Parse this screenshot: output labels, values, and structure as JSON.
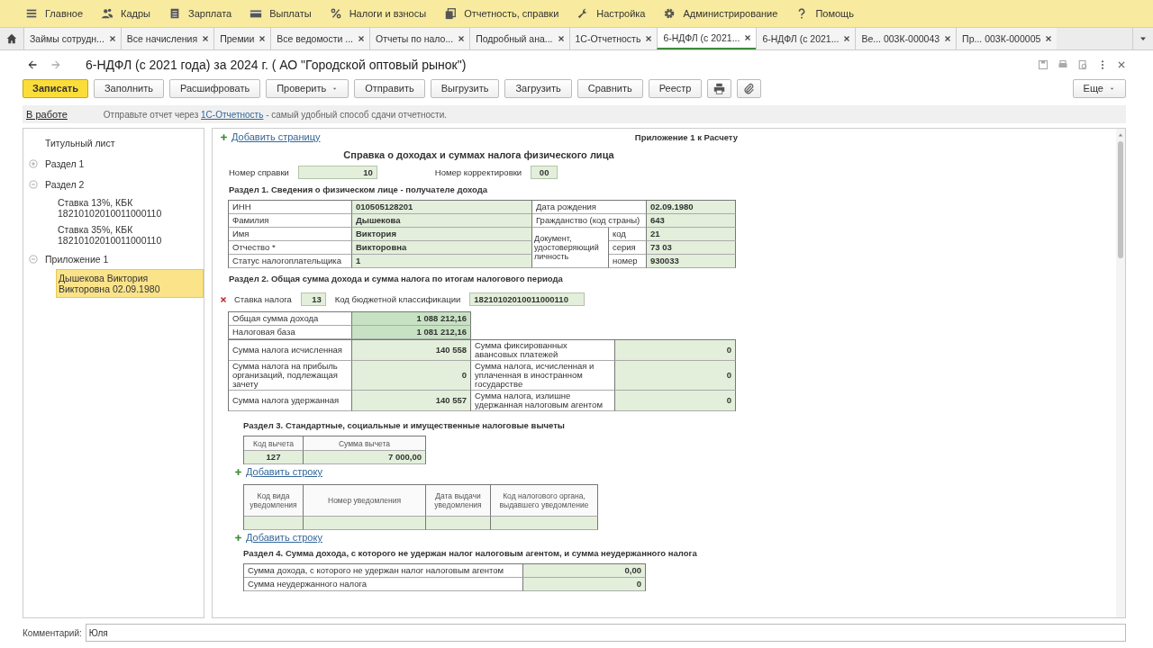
{
  "menu": [
    {
      "label": "Главное"
    },
    {
      "label": "Кадры"
    },
    {
      "label": "Зарплата"
    },
    {
      "label": "Выплаты"
    },
    {
      "label": "Налоги и взносы"
    },
    {
      "label": "Отчетность, справки"
    },
    {
      "label": "Настройка"
    },
    {
      "label": "Администрирование"
    },
    {
      "label": "Помощь"
    }
  ],
  "tabs": [
    {
      "label": "Займы сотрудн...",
      "selected": false
    },
    {
      "label": "Все начисления",
      "selected": false
    },
    {
      "label": "Премии",
      "selected": false
    },
    {
      "label": "Все ведомости ...",
      "selected": false
    },
    {
      "label": "Отчеты по нало...",
      "selected": false
    },
    {
      "label": "Подробный ана...",
      "selected": false
    },
    {
      "label": "1С-Отчетность",
      "selected": false
    },
    {
      "label": "6-НДФЛ (с 2021...",
      "selected": true
    },
    {
      "label": "6-НДФЛ (с 2021...",
      "selected": false
    },
    {
      "label": "Ве... 003К-000043",
      "selected": false
    },
    {
      "label": "Пр... 003К-000005",
      "selected": false
    }
  ],
  "window": {
    "title": "6-НДФЛ (с 2021 года) за 2024 г. ( АО \"Городской оптовый рынок\")"
  },
  "toolbar": [
    {
      "kind": "primary",
      "label": "Записать"
    },
    {
      "kind": "plain",
      "label": "Заполнить"
    },
    {
      "kind": "plain",
      "label": "Расшифровать"
    },
    {
      "kind": "menu",
      "label": "Проверить"
    },
    {
      "kind": "plain",
      "label": "Отправить"
    },
    {
      "kind": "plain",
      "label": "Выгрузить"
    },
    {
      "kind": "plain",
      "label": "Загрузить"
    },
    {
      "kind": "plain",
      "label": "Сравнить"
    },
    {
      "kind": "plain",
      "label": "Реестр"
    },
    {
      "kind": "print"
    },
    {
      "kind": "attach"
    }
  ],
  "more_button": {
    "label": "Еще"
  },
  "infobar": {
    "status": "В работе",
    "message_before": "Отправьте отчет через ",
    "message_link": "1С-Отчетность",
    "message_after": " - самый удобный способ сдачи отчетности."
  },
  "tree": [
    {
      "label": "Титульный лист",
      "selected": false
    },
    {
      "label": "Раздел 1",
      "expanded": false,
      "selected": false
    },
    {
      "label": "Раздел 2",
      "expanded": true,
      "selected": false,
      "children": [
        {
          "label": "Ставка 13%, КБК 18210102010011000110",
          "selected": false
        },
        {
          "label": "Ставка 35%, КБК 18210102010011000110",
          "selected": false
        }
      ]
    },
    {
      "label": "Приложение 1",
      "expanded": true,
      "selected": false,
      "children": [
        {
          "label": "Дышекова Виктория Викторовна 02.09.1980",
          "selected": true
        }
      ]
    }
  ],
  "report": {
    "add_page": "Добавить страницу",
    "appendix": "Приложение 1 к Расчету",
    "heading": "Справка о доходах и суммах налога физического лица",
    "number_label": "Номер справки",
    "number_value": "10",
    "correction_label": "Номер корректировки",
    "correction_value": "00",
    "section1": {
      "title": "Раздел 1. Сведения о физическом лице - получателе дохода",
      "left": [
        {
          "label": "ИНН",
          "value": "010505128201"
        },
        {
          "label": "Фамилия",
          "value": "Дышекова"
        },
        {
          "label": "Имя",
          "value": "Виктория"
        },
        {
          "label": "Отчество *",
          "value": "Викторовна"
        },
        {
          "label": "Статус налогоплательщика",
          "value": "1"
        }
      ],
      "right": [
        {
          "label": "Дата рождения",
          "value": "02.09.1980"
        },
        {
          "label": "Гражданство (код страны)",
          "value": "643"
        }
      ],
      "document": {
        "label": "Документ, удостоверяющий личность",
        "fields": [
          {
            "label": "код",
            "value": "21"
          },
          {
            "label": "серия",
            "value": "73 03"
          },
          {
            "label": "номер",
            "value": "930033"
          }
        ]
      }
    },
    "section2": {
      "title": "Раздел 2. Общая сумма дохода и сумма налога по итогам налогового периода",
      "rate_label": "Ставка налога",
      "rate_value": "13",
      "kbk_label": "Код бюджетной классификации",
      "kbk_value": "18210102010011000110",
      "totals": [
        {
          "label": "Общая сумма дохода",
          "value": "1 088 212,16"
        },
        {
          "label": "Налоговая база",
          "value": "1 081 212,16"
        }
      ],
      "rows": [
        {
          "label": "Сумма налога исчисленная",
          "value": "140 558",
          "label2": "Сумма фиксированных авансовых платежей",
          "value2": "0"
        },
        {
          "label": "Сумма налога на прибыль организаций, подлежащая зачету",
          "value": "0",
          "label2": "Сумма налога, исчисленная и уплаченная в иностранном государстве",
          "value2": "0"
        },
        {
          "label": "Сумма налога удержанная",
          "value": "140 557",
          "label2": "Сумма налога, излишне удержанная налоговым агентом",
          "value2": "0"
        }
      ]
    },
    "section3": {
      "title": "Раздел 3. Стандартные, социальные и имущественные налоговые вычеты",
      "deduction_columns": [
        "Код вычета",
        "Сумма вычета"
      ],
      "deductions": [
        [
          "127",
          "7 000,00"
        ]
      ],
      "add_row": "Добавить строку",
      "notice_columns": [
        "Код вида уведомления",
        "Номер уведомления",
        "Дата выдачи уведомления",
        "Код налогового органа, выдавшего уведомление"
      ],
      "add_notice_row": "Добавить строку"
    },
    "section4": {
      "title": "Раздел 4. Сумма дохода, с которого не удержан налог налоговым агентом, и сумма неудержанного налога",
      "rows": [
        {
          "label": "Сумма дохода, с которого не удержан налог налоговым агентом",
          "value": "0,00"
        },
        {
          "label": "Сумма неудержанного налога",
          "value": "0"
        }
      ]
    }
  },
  "comment": {
    "label": "Комментарий:",
    "value": "Юля"
  }
}
